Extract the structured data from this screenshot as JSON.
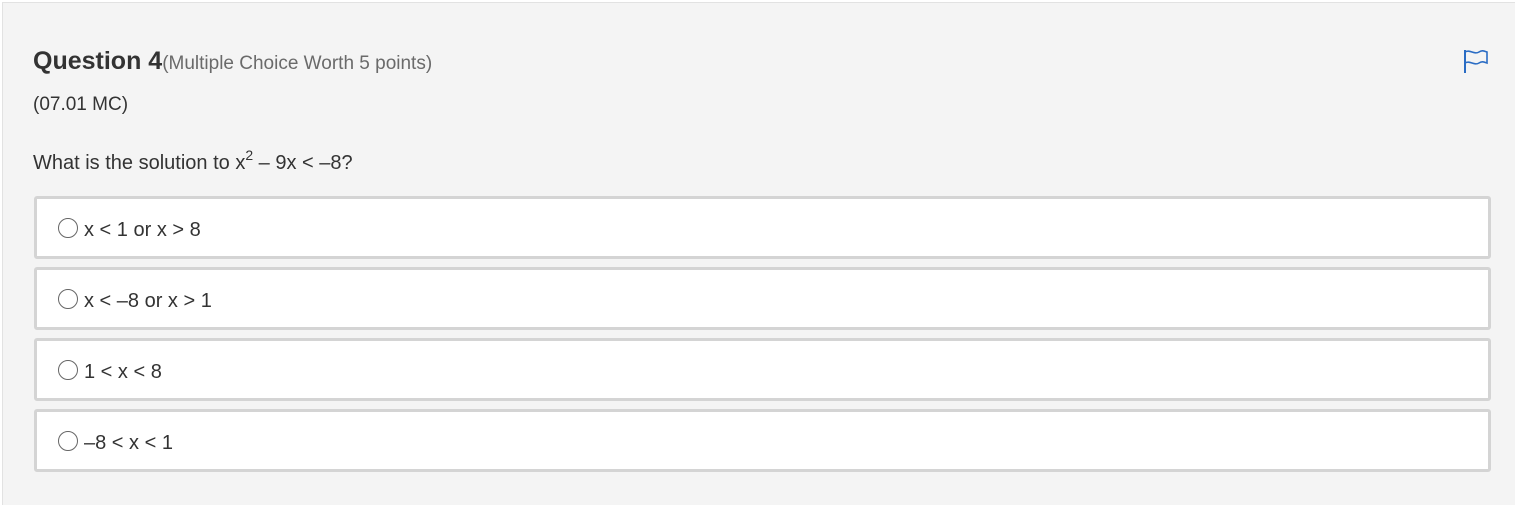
{
  "question": {
    "title": "Question 4",
    "meta": "(Multiple Choice Worth 5 points)",
    "code": "(07.01 MC)",
    "prompt_before": "What is the solution to x",
    "prompt_exponent": "2",
    "prompt_after": " – 9x < –8?",
    "flag_icon": "flag-icon",
    "accent_color": "#2a6cc4"
  },
  "options": [
    {
      "label": "x < 1 or x > 8"
    },
    {
      "label": "x < –8 or x > 1"
    },
    {
      "label": "1 < x < 8"
    },
    {
      "label": "–8 < x < 1"
    }
  ]
}
